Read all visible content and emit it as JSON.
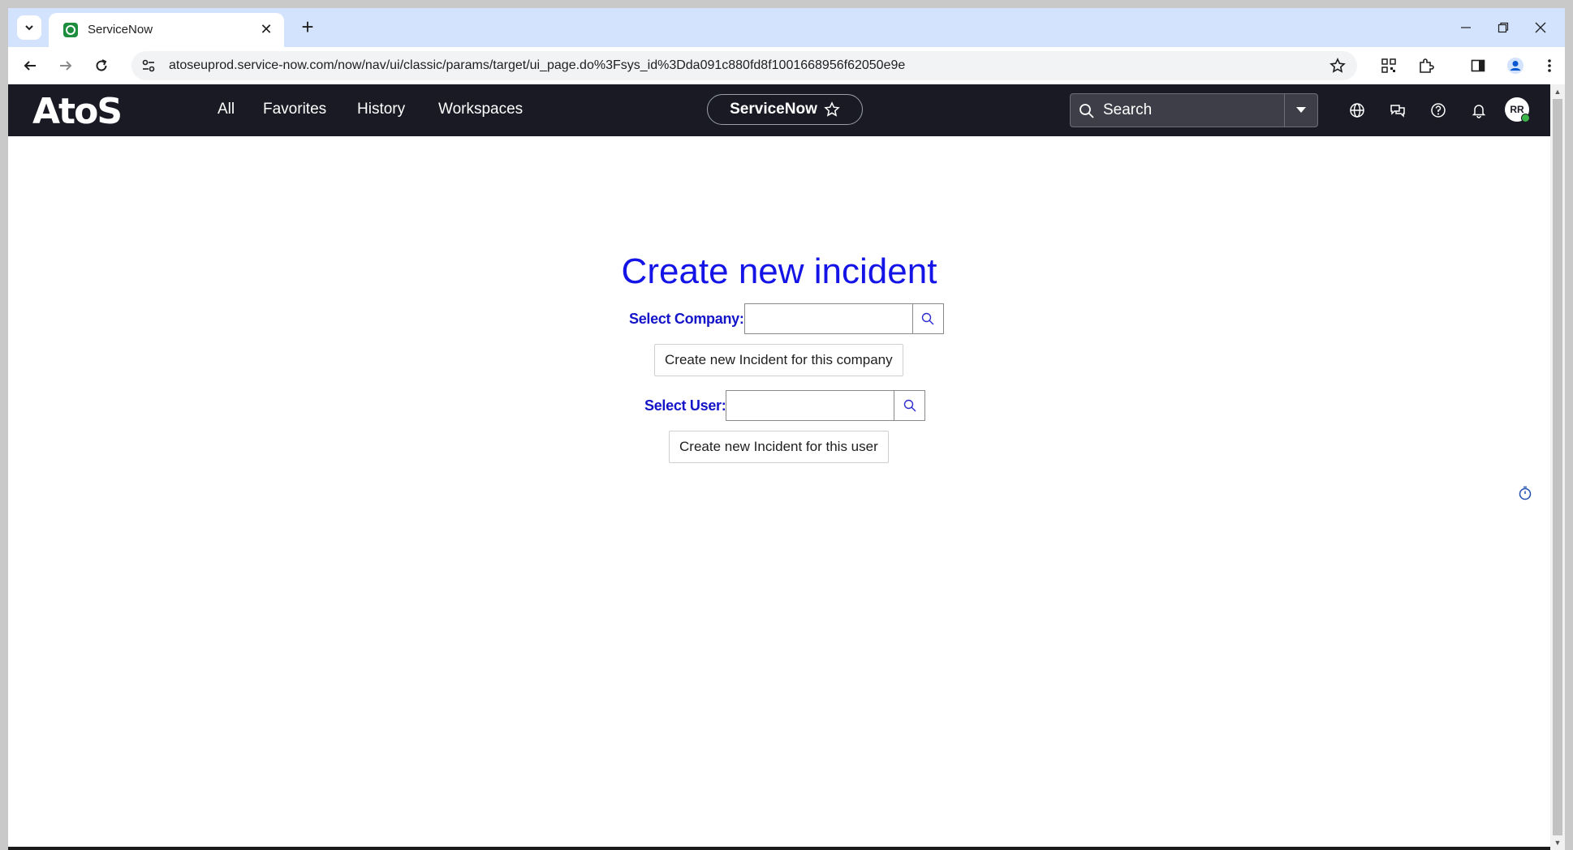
{
  "browser": {
    "tab_title": "ServiceNow",
    "url": "atoseuprod.service-now.com/now/nav/ui/classic/params/target/ui_page.do%3Fsys_id%3Dda091c880fd8f1001668956f62050e9e"
  },
  "header": {
    "logo": "AtoS",
    "menu": [
      "All",
      "Favorites",
      "History",
      "Workspaces"
    ],
    "app_name": "ServiceNow",
    "search_placeholder": "Search",
    "avatar_initials": "RR"
  },
  "form": {
    "title": "Create new incident",
    "company_label": "Select Company:",
    "company_value": "",
    "company_button": "Create new Incident for this company",
    "user_label": "Select User:",
    "user_value": "",
    "user_button": "Create new Incident for this user"
  },
  "colors": {
    "header_bg": "#1a1a24",
    "title_blue": "#1414e6",
    "tabstrip_bg": "#d3e3fd"
  }
}
